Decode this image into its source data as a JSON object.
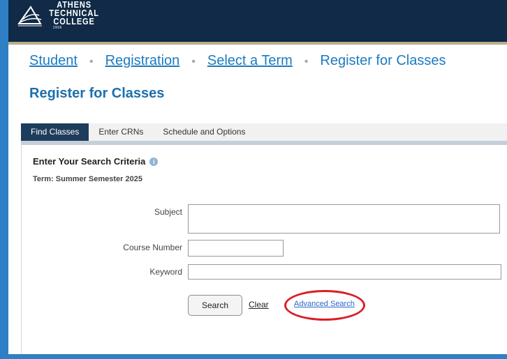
{
  "logo": {
    "lines": [
      "ATHENS",
      "TECHNICAL",
      "COLLEGE"
    ],
    "year": "1958",
    "icon": "college-logo-icon"
  },
  "breadcrumb": {
    "items": [
      "Student",
      "Registration",
      "Select a Term"
    ],
    "current": "Register for Classes",
    "separator": "•"
  },
  "page": {
    "title": "Register for Classes"
  },
  "tabs": [
    {
      "label": "Find Classes",
      "active": true
    },
    {
      "label": "Enter CRNs",
      "active": false
    },
    {
      "label": "Schedule and Options",
      "active": false
    }
  ],
  "criteria": {
    "title": "Enter Your Search Criteria",
    "info_icon": "info-icon",
    "term": "Term: Summer Semester 2025"
  },
  "form": {
    "subject_label": "Subject",
    "subject_value": "",
    "course_number_label": "Course Number",
    "course_number_value": "",
    "keyword_label": "Keyword",
    "keyword_value": ""
  },
  "actions": {
    "search": "Search",
    "clear": "Clear",
    "advanced": "Advanced Search"
  },
  "colors": {
    "header": "#102a47",
    "link": "#1c7bc0",
    "active_tab": "#1e3d5c",
    "highlight": "#d91f26",
    "outer_border": "#2f7fc6"
  }
}
